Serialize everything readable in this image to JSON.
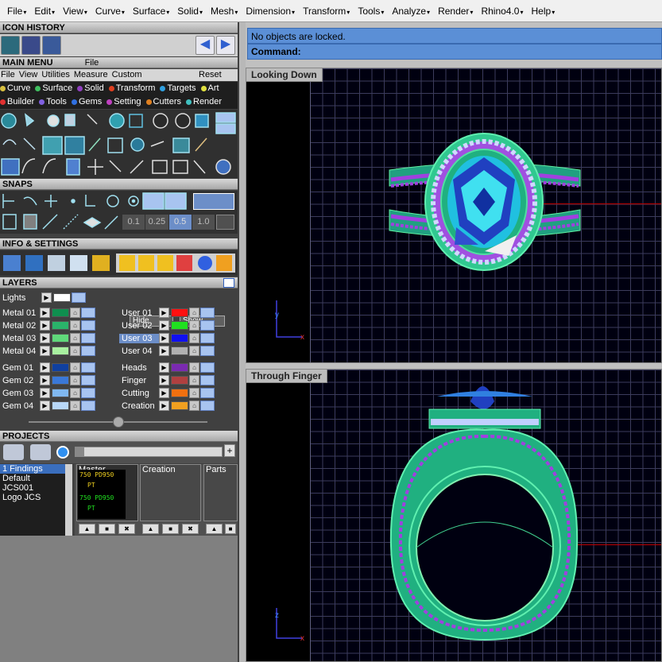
{
  "menubar": {
    "items": [
      "File",
      "Edit",
      "View",
      "Curve",
      "Surface",
      "Solid",
      "Mesh",
      "Dimension",
      "Transform",
      "Tools",
      "Analyze",
      "Render",
      "Rhino4.0",
      "Help"
    ]
  },
  "sections": {
    "icon_history": "ICON HISTORY",
    "main_menu": "MAIN MENU",
    "main_menu_file": "File",
    "snaps": "SNAPS",
    "info_settings": "INFO & SETTINGS",
    "layers": "LAYERS",
    "projects": "PROJECTS"
  },
  "main_menu": {
    "row1": [
      "File",
      "View",
      "Utilities",
      "Measure",
      "Custom"
    ],
    "reset": "Reset",
    "row2": [
      {
        "label": "Curve",
        "color": "#d8c040"
      },
      {
        "label": "Surface",
        "color": "#40c060"
      },
      {
        "label": "Solid",
        "color": "#9040c0"
      },
      {
        "label": "Transform",
        "color": "#e04020"
      },
      {
        "label": "Targets",
        "color": "#30a0e0"
      },
      {
        "label": "Art",
        "color": "#e0e040"
      }
    ],
    "row3": [
      {
        "label": "Builder",
        "color": "#e03030"
      },
      {
        "label": "Tools",
        "color": "#8060e0"
      },
      {
        "label": "Gems",
        "color": "#3070e0"
      },
      {
        "label": "Setting",
        "color": "#c040c0"
      },
      {
        "label": "Cutters",
        "color": "#e08020"
      },
      {
        "label": "Render",
        "color": "#40c0c0"
      }
    ]
  },
  "snaps": {
    "values": [
      "0.1",
      "0.25",
      "0.5",
      "1.0"
    ]
  },
  "layers": {
    "lights": "Lights",
    "hide": "Hide",
    "show": "Show",
    "left": [
      {
        "name": "Metal 01",
        "color": "#0f8f4f"
      },
      {
        "name": "Metal 02",
        "color": "#2ab36a"
      },
      {
        "name": "Metal 03",
        "color": "#5fd87a"
      },
      {
        "name": "Metal 04",
        "color": "#a8f0a0"
      },
      {
        "name": "Gem 01",
        "color": "#1040a0"
      },
      {
        "name": "Gem 02",
        "color": "#3a78d8"
      },
      {
        "name": "Gem 03",
        "color": "#80b8f0"
      },
      {
        "name": "Gem 04",
        "color": "#b8d8f8"
      }
    ],
    "right": [
      {
        "name": "User 01",
        "color": "#ff1010"
      },
      {
        "name": "User 02",
        "color": "#20e020"
      },
      {
        "name": "User 03",
        "color": "#1010f0"
      },
      {
        "name": "User 04",
        "color": "#b0b0b0"
      },
      {
        "name": "Heads",
        "color": "#7a2ab0"
      },
      {
        "name": "Finger",
        "color": "#b04040"
      },
      {
        "name": "Cutting",
        "color": "#f07010"
      },
      {
        "name": "Creation",
        "color": "#f0a020"
      }
    ]
  },
  "projects": {
    "list": [
      "1 Findings",
      "Default",
      "JCS001",
      "Logo JCS"
    ],
    "panels": [
      "Master",
      "Creation",
      "Parts"
    ],
    "thumb_text": [
      "750 PD950",
      "PT",
      "750 PD950",
      "PT"
    ]
  },
  "command": {
    "status": "No objects are locked.",
    "prompt": "Command:"
  },
  "viewports": {
    "top": "Looking Down",
    "bottom": "Through Finger"
  },
  "axes": {
    "top_v": "y",
    "top_h": "x",
    "bottom_v": "z",
    "bottom_h": "x"
  }
}
